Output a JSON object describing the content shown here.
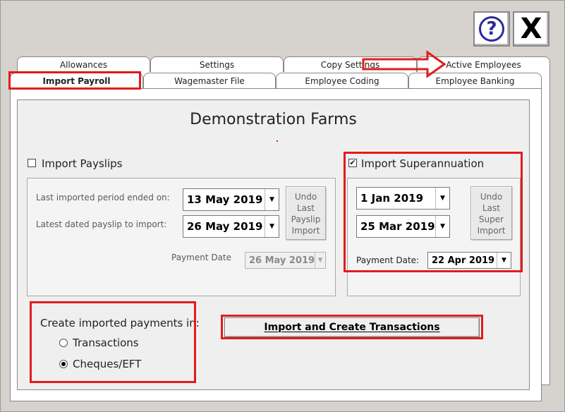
{
  "window": {
    "help_icon": "question-mark-icon",
    "close_icon": "close-x-icon",
    "help_glyph": "?",
    "close_glyph": "X"
  },
  "tabs": {
    "back_row": [
      "Allowances",
      "Settings",
      "Copy Settings",
      "Active Employees"
    ],
    "front_row": [
      "Import Payroll",
      "Wagemaster File",
      "Employee Coding",
      "Employee Banking"
    ],
    "active": "Import Payroll"
  },
  "main": {
    "company_title": "Demonstration Farms"
  },
  "payslips": {
    "checkbox_label": "Import Payslips",
    "checked": false,
    "last_imported_label": "Last imported period ended on:",
    "last_imported_value": "13 May 2019",
    "latest_dated_label": "Latest dated payslip to import:",
    "latest_dated_value": "26 May 2019",
    "undo_label": "Undo\nLast\nPayslip\nImport",
    "payment_date_label": "Payment Date",
    "payment_date_value": "26 May 2019"
  },
  "super": {
    "checkbox_label": "Import Superannuation",
    "checked": true,
    "check_glyph": "✔",
    "from_value": "1  Jan  2019",
    "to_value": "25 Mar 2019",
    "undo_label": "Undo\nLast\nSuper\nImport",
    "payment_date_label": "Payment Date:",
    "payment_date_value": "22 Apr  2019"
  },
  "create_in": {
    "label": "Create imported payments in:",
    "options": [
      "Transactions",
      "Cheques/EFT"
    ],
    "selected": "Cheques/EFT"
  },
  "actions": {
    "import_button_label": "Import and Create Transactions"
  },
  "annotations": {
    "highlight_color": "#e11c1c"
  }
}
